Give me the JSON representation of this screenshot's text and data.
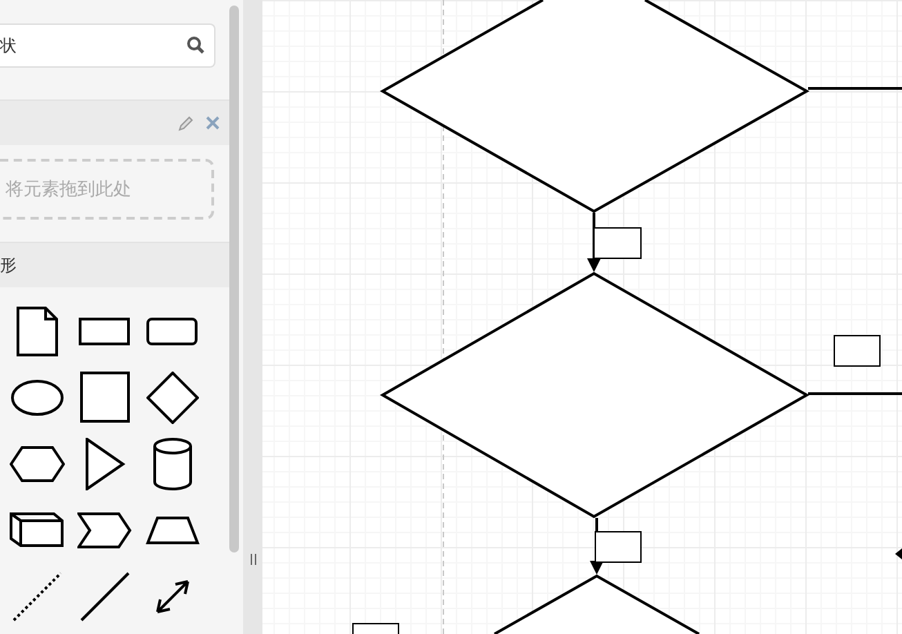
{
  "sidebar": {
    "search": {
      "placeholder": "状"
    },
    "scratchpad": {
      "drop_hint": "将元素拖到此处"
    },
    "shapes_section": {
      "title": "形"
    }
  }
}
